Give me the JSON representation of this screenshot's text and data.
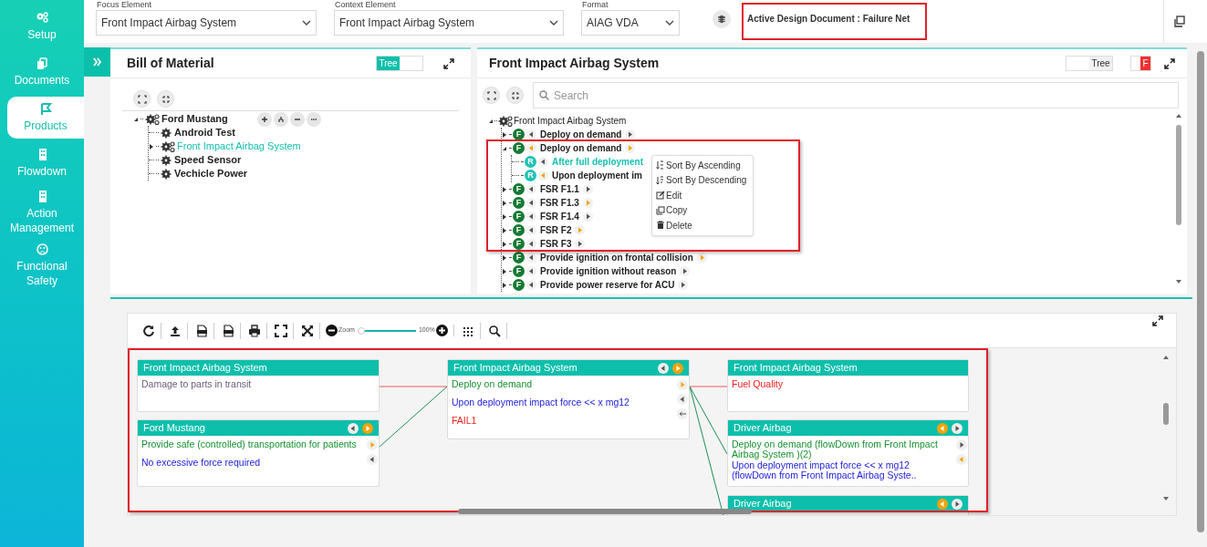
{
  "sidebar": {
    "items": [
      {
        "label": "Setup",
        "kind": "gears",
        "selected": false
      },
      {
        "label": "Documents",
        "kind": "copy",
        "selected": false
      },
      {
        "label": "Products",
        "kind": "flag",
        "selected": true
      },
      {
        "label": "Flowdown",
        "kind": "building",
        "selected": false
      },
      {
        "label": "Action Management",
        "kind": "building",
        "selected": false
      },
      {
        "label": "Functional Safety",
        "kind": "face",
        "selected": false
      }
    ]
  },
  "top_bar": {
    "fields": [
      {
        "label": "Focus Element",
        "value": "Front Impact Airbag System"
      },
      {
        "label": "Context Element",
        "value": "Front Impact Airbag System"
      },
      {
        "label": "Format",
        "value": "AIAG VDA"
      }
    ],
    "active_document": "Active Design Document : Failure Net"
  },
  "bom_panel": {
    "title": "Bill of Material",
    "toggle": {
      "label": "Tree",
      "on": true
    },
    "tree": [
      {
        "label": "Ford Mustang",
        "kind": "assembly",
        "expanded": true,
        "selected": false,
        "children": [
          {
            "label": "Android Test",
            "kind": "part",
            "selected": false
          },
          {
            "label": "Front Impact Airbag System",
            "kind": "assembly",
            "selected": true,
            "expanded": false
          },
          {
            "label": "Speed Sensor",
            "kind": "part",
            "selected": false
          },
          {
            "label": "Vechicle Power",
            "kind": "part",
            "selected": false
          }
        ]
      }
    ]
  },
  "function_panel": {
    "title": "Front Impact Airbag System",
    "toggle": {
      "label": "Tree",
      "on": false
    },
    "filter_badge": "F",
    "search": {
      "placeholder": "Search"
    },
    "root": "Front Impact Airbag System",
    "tree": [
      {
        "badge": "F",
        "label": "Deploy on demand",
        "left_active": false,
        "right_active": false,
        "expanded": false,
        "selected": false
      },
      {
        "badge": "F",
        "label": "Deploy on demand",
        "left_active": true,
        "right_active": true,
        "expanded": true,
        "selected": false,
        "children": [
          {
            "badge": "R",
            "label": "After full deployment",
            "left_active": false,
            "selected": true
          },
          {
            "badge": "R",
            "label": "Upon deployment im",
            "left_active": true,
            "selected": false
          }
        ]
      },
      {
        "badge": "F",
        "label": "FSR F1.1",
        "left_active": false,
        "right_active": false,
        "expanded": false,
        "selected": false
      },
      {
        "badge": "F",
        "label": "FSR F1.3",
        "left_active": false,
        "right_active": true,
        "expanded": false,
        "selected": false
      },
      {
        "badge": "F",
        "label": "FSR F1.4",
        "left_active": false,
        "right_active": false,
        "expanded": false,
        "selected": false
      },
      {
        "badge": "F",
        "label": "FSR F2",
        "left_active": false,
        "right_active": true,
        "expanded": false,
        "selected": false
      },
      {
        "badge": "F",
        "label": "FSR F3",
        "left_active": false,
        "right_active": false,
        "expanded": false,
        "selected": false
      },
      {
        "badge": "F",
        "label": "Provide ignition on frontal collision",
        "left_active": false,
        "right_active": true,
        "expanded": false,
        "selected": false
      },
      {
        "badge": "F",
        "label": "Provide ignition without reason",
        "left_active": false,
        "right_active": false,
        "expanded": false,
        "selected": false
      },
      {
        "badge": "F",
        "label": "Provide power reserve for ACU",
        "left_active": false,
        "right_active": false,
        "expanded": false,
        "selected": false
      }
    ],
    "context_menu": [
      {
        "kind": "sort_asc",
        "label": "Sort By Ascending"
      },
      {
        "kind": "sort_desc",
        "label": "Sort By Descending"
      },
      {
        "kind": "edit",
        "label": "Edit"
      },
      {
        "kind": "copy",
        "label": "Copy"
      },
      {
        "kind": "delete",
        "label": "Delete"
      }
    ]
  },
  "diagram": {
    "zoom": {
      "label": "Zoom",
      "level": 0.06,
      "value": "100%"
    },
    "cards": [
      {
        "title": "Front Impact Airbag System",
        "lines": [
          {
            "kind": "effect",
            "text": "Damage to parts in transit"
          }
        ]
      },
      {
        "title": "Ford Mustang",
        "header_buttons": [
          {
            "active": false
          },
          {
            "active": true
          }
        ],
        "lines": [
          {
            "kind": "function",
            "text": "Provide safe (controlled) transportation for patients"
          },
          {
            "kind": "requirement",
            "text": "No excessive force required"
          }
        ],
        "side_buttons": [
          {
            "kind": "right",
            "active": true
          },
          {
            "kind": "left",
            "active": false
          }
        ]
      },
      {
        "title": "Front Impact Airbag System",
        "header_buttons": [
          {
            "active": false
          },
          {
            "active": true
          }
        ],
        "lines": [
          {
            "kind": "function",
            "text": "Deploy on demand"
          },
          {
            "kind": "requirement",
            "text": "Upon deployment impact force << x mg12"
          },
          {
            "kind": "failure",
            "text": "FAIL1"
          }
        ],
        "side_buttons": [
          {
            "kind": "right",
            "active": true
          },
          {
            "kind": "left",
            "active": false
          },
          {
            "kind": "back"
          }
        ]
      },
      {
        "title": "Front Impact Airbag System",
        "lines": [
          {
            "kind": "failure",
            "text": "Fuel Quality"
          }
        ]
      },
      {
        "title": "Driver Airbag",
        "header_buttons": [
          {
            "active": true
          },
          {
            "active": false
          }
        ],
        "lines": [
          {
            "kind": "function",
            "text": "Deploy on demand (flowDown from Front Impact Airbag System )(2)"
          },
          {
            "kind": "requirement",
            "text": "Upon deployment impact force << x mg12 (flowDown from Front Impact Airbag Syste.."
          }
        ],
        "side_buttons": [
          {
            "kind": "right",
            "active": false
          },
          {
            "kind": "left",
            "active": true
          }
        ]
      },
      {
        "title": "Driver Airbag",
        "header_buttons": [
          {
            "active": true
          },
          {
            "active": false
          }
        ]
      }
    ]
  }
}
